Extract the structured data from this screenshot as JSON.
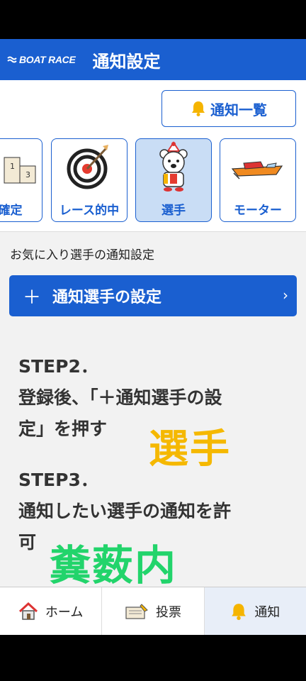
{
  "header": {
    "logo_text": "BOAT RACE",
    "title": "通知設定"
  },
  "notice_list_button": {
    "label": "通知一覧"
  },
  "tabs": [
    {
      "label": "ス確定",
      "icon": "podium-icon"
    },
    {
      "label": "レース的中",
      "icon": "target-icon"
    },
    {
      "label": "選手",
      "icon": "bear-mascot-icon",
      "active": true
    },
    {
      "label": "モーター",
      "icon": "boat-icon"
    }
  ],
  "section_label": "お気に入り選手の通知設定",
  "setting_button": {
    "plus": "＋",
    "label": "通知選手の設定",
    "chevron": "›"
  },
  "steps": {
    "step2_title": "STEP2．",
    "step2_line1": "登録後、「＋通知選手の設",
    "step2_line2": "定」を押す",
    "step3_title": "STEP3．",
    "step3_line1": "通知したい選手の通知を許",
    "step3_line2": "可"
  },
  "overlay": {
    "text1": "選手",
    "text2": "糞薮内"
  },
  "bottom_nav": [
    {
      "label": "ホーム",
      "icon": "home-icon"
    },
    {
      "label": "投票",
      "icon": "ticket-icon"
    },
    {
      "label": "通知",
      "icon": "bell-icon",
      "active": true
    }
  ],
  "colors": {
    "brand": "#1a5fd0",
    "active_tab": "#c9ddf5",
    "overlay1": "#f5b800",
    "overlay2": "#22d46b"
  }
}
